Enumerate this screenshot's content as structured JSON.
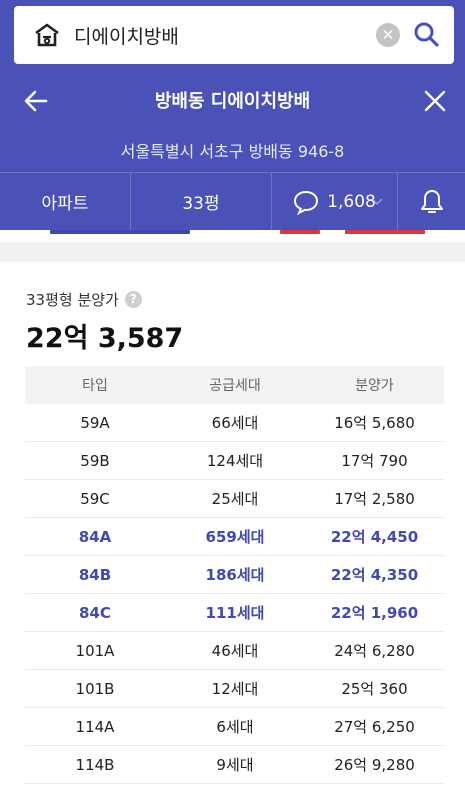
{
  "search": {
    "query": "디에이치방배",
    "clear_icon": "close-circle-icon",
    "search_icon": "search-icon",
    "logo_icon": "house-logo-icon"
  },
  "header": {
    "title": "방배동 디에이치방배",
    "address": "서울특별시 서초구 방배동 946-8",
    "back_icon": "arrow-left-icon",
    "close_icon": "close-icon",
    "accent_color": "#4a52b8"
  },
  "tabs": {
    "type_label": "아파트",
    "size_label": "33평",
    "comment_count": "1,608",
    "comment_icon": "speech-bubble-icon",
    "bell_icon": "bell-icon",
    "dropdown_icon": "chevron-down-icon"
  },
  "summary": {
    "label": "33평형 분양가",
    "help_icon": "question-circle-icon",
    "help_text": "?",
    "price": "22억 3,587"
  },
  "table": {
    "headers": [
      "타입",
      "공급세대",
      "분양가"
    ],
    "highlight_color": "#4248b5",
    "rows": [
      {
        "type": "59A",
        "units": "66세대",
        "price": "16억 5,680",
        "highlight": false
      },
      {
        "type": "59B",
        "units": "124세대",
        "price": "17억 790",
        "highlight": false
      },
      {
        "type": "59C",
        "units": "25세대",
        "price": "17억 2,580",
        "highlight": false
      },
      {
        "type": "84A",
        "units": "659세대",
        "price": "22억 4,450",
        "highlight": true
      },
      {
        "type": "84B",
        "units": "186세대",
        "price": "22억 4,350",
        "highlight": true
      },
      {
        "type": "84C",
        "units": "111세대",
        "price": "22억 1,960",
        "highlight": true
      },
      {
        "type": "101A",
        "units": "46세대",
        "price": "24억 6,280",
        "highlight": false
      },
      {
        "type": "101B",
        "units": "12세대",
        "price": "25억 360",
        "highlight": false
      },
      {
        "type": "114A",
        "units": "6세대",
        "price": "27억 6,250",
        "highlight": false
      },
      {
        "type": "114B",
        "units": "9세대",
        "price": "26억 9,280",
        "highlight": false
      }
    ]
  }
}
